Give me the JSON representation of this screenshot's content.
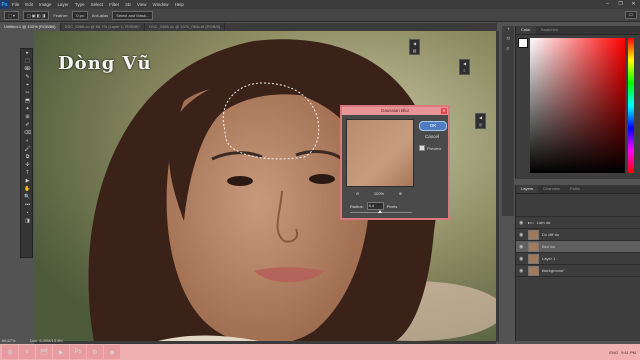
{
  "menubar": {
    "logo": "Ps",
    "items": [
      "File",
      "Edit",
      "Image",
      "Layer",
      "Type",
      "Select",
      "Filter",
      "3D",
      "View",
      "Window",
      "Help"
    ]
  },
  "window_controls": {
    "minimize": "–",
    "restore": "❐",
    "close": "✕"
  },
  "options_bar": {
    "feather_label": "Feather:",
    "feather_value": "0 px",
    "anti_alias": "Anti-alias",
    "select_mask": "Select and Mask..."
  },
  "document_tabs": [
    "Untitled-1 @ 100% (RGB/8#)",
    "DSC_0365-cc @ 66.7% (Layer 1, RGB/8)*",
    "DSC_0365-cc @ 1970_063c.tif (RGB/8)"
  ],
  "watermark": "Dòng Vũ",
  "tools": [
    "▸",
    "⬚",
    "ↂ",
    "✎",
    "⌖",
    "✂",
    "⬒",
    "✦",
    "⊞",
    "✐",
    "⌫",
    "◐",
    "🖌",
    "⧉",
    "✣",
    "T",
    "▶",
    "✋",
    "🔍",
    "•••",
    "▪",
    "◨"
  ],
  "right_panel": {
    "color_tabs": [
      "Color",
      "Swatches"
    ],
    "color": {
      "fg": "#ffffff",
      "bg": "#000000",
      "picker_hue": "#ff0000"
    },
    "layers_tabs": [
      "Layers",
      "Channels",
      "Paths"
    ],
    "layers": [
      {
        "name": "Lam da",
        "type": "group"
      },
      {
        "name": "Do diff do",
        "type": "layer"
      },
      {
        "name": "Blur da",
        "type": "layer",
        "selected": true
      },
      {
        "name": "Layer 1",
        "type": "layer"
      },
      {
        "name": "Background",
        "type": "layer"
      }
    ]
  },
  "dialog": {
    "title": "Gaussian Blur",
    "ok": "OK",
    "cancel": "Cancel",
    "preview": "Preview",
    "zoom": "100%",
    "radius_label": "Radius:",
    "radius_value": "8,4",
    "radius_unit": "Pixels"
  },
  "status": {
    "zoom": "66,67%",
    "doc": "Doc: 6,49M/13,9M"
  },
  "taskbar": {
    "apps": [
      "⊞",
      "e",
      "🗂",
      "▶",
      "Ps",
      "⚙",
      "◉"
    ],
    "time": "9:41 PM",
    "language": "ENG"
  }
}
